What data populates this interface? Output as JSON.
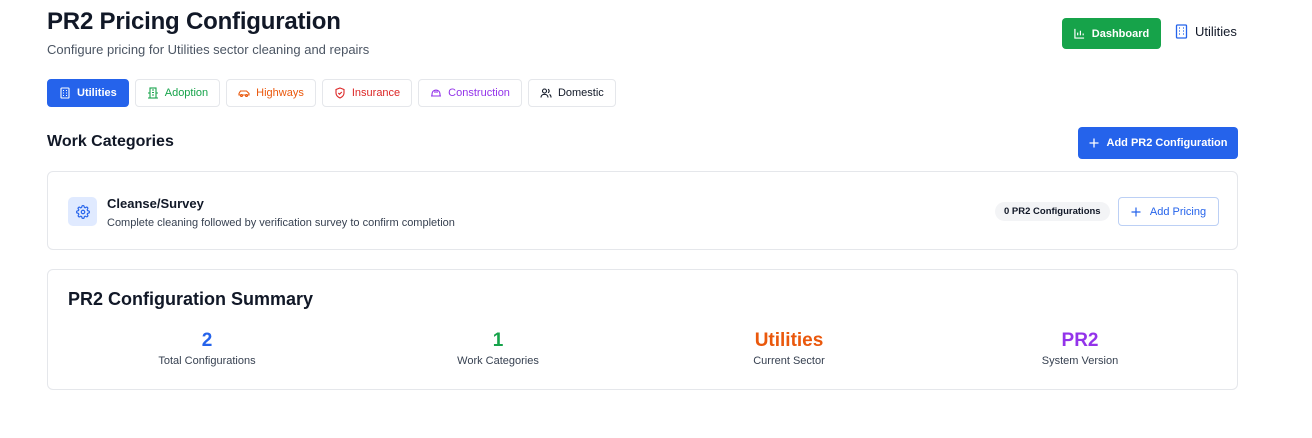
{
  "header": {
    "title": "PR2 Pricing Configuration",
    "subtitle": "Configure pricing for Utilities sector cleaning and repairs",
    "dashboard_label": "Dashboard",
    "current_sector_label": "Utilities"
  },
  "tabs": [
    {
      "label": "Utilities",
      "icon": "building-icon",
      "color": "#2563eb",
      "active": true
    },
    {
      "label": "Adoption",
      "icon": "building-columns-icon",
      "color": "#16a34a",
      "active": false
    },
    {
      "label": "Highways",
      "icon": "car-icon",
      "color": "#ea580c",
      "active": false
    },
    {
      "label": "Insurance",
      "icon": "shield-icon",
      "color": "#dc2626",
      "active": false
    },
    {
      "label": "Construction",
      "icon": "hard-hat-icon",
      "color": "#9333ea",
      "active": false
    },
    {
      "label": "Domestic",
      "icon": "users-icon",
      "color": "#111827",
      "active": false
    }
  ],
  "work_categories": {
    "title": "Work Categories",
    "add_button_label": "Add PR2 Configuration",
    "items": [
      {
        "name": "Cleanse/Survey",
        "description": "Complete cleaning followed by verification survey to confirm completion",
        "icon": "gear-icon",
        "badge": "0 PR2 Configurations",
        "add_pricing_label": "Add Pricing"
      }
    ]
  },
  "summary": {
    "title": "PR2 Configuration Summary",
    "stats": [
      {
        "value": "2",
        "label": "Total Configurations",
        "color": "#2563eb"
      },
      {
        "value": "1",
        "label": "Work Categories",
        "color": "#16a34a"
      },
      {
        "value": "Utilities",
        "label": "Current Sector",
        "color": "#ea580c"
      },
      {
        "value": "PR2",
        "label": "System Version",
        "color": "#9333ea"
      }
    ]
  },
  "colors": {
    "primary": "#2563eb",
    "success": "#16a34a"
  }
}
